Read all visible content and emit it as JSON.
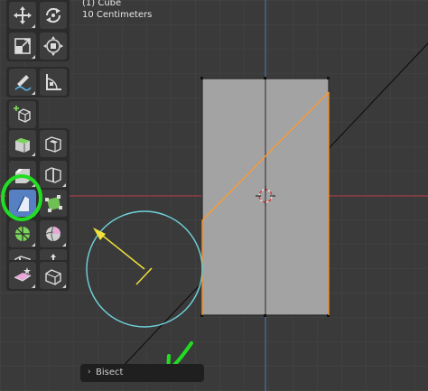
{
  "header": {
    "object_info": "(1) Cube",
    "scale_info": "10 Centimeters"
  },
  "toolbar": {
    "tools": [
      "move",
      "rotate",
      "scale",
      "transform",
      "annotate",
      "measure",
      "add-cube",
      "extrude-region",
      "inset-faces",
      "bevel",
      "loop-cut",
      "knife",
      "poly-build",
      "spin",
      "smooth",
      "edge-slide",
      "shrink-fatten",
      "shear",
      "rip-region"
    ],
    "active_tool": "bisect"
  },
  "operator_panel": {
    "chevron": "›",
    "label": "Bisect"
  },
  "colors": {
    "background": "#3a3a3a",
    "grid": "#454545",
    "face": "#a3a3a3",
    "selected_edge": "#ff9a2e",
    "bisect_line": "#0a0a0a",
    "x_axis": "#9c3a40",
    "y_axis": "#4a6fa0",
    "gizmo_circle": "#6fd3db",
    "gizmo_arrow": "#f0e23a",
    "annotation": "#22dd22",
    "active_tool": "#5680c2"
  }
}
